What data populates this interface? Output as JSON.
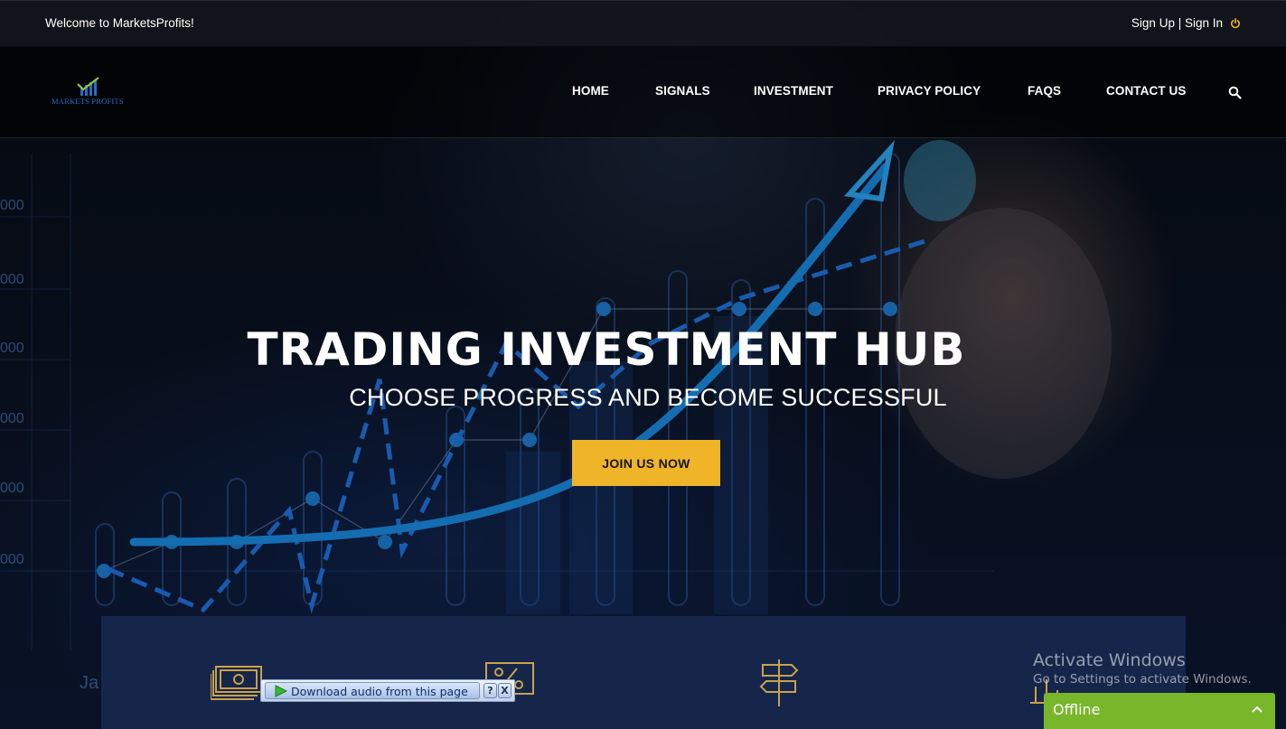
{
  "topbar": {
    "welcome": "Welcome to MarketsProfits!",
    "auth": "Sign Up | Sign In"
  },
  "logo": {
    "text": "MARKETS PROFITS"
  },
  "nav": {
    "items": [
      "HOME",
      "SIGNALS",
      "INVESTMENT",
      "PRIVACY POLICY",
      "FAQS",
      "CONTACT US"
    ]
  },
  "hero": {
    "title": "TRADING INVESTMENT HUB",
    "subtitle": "CHOOSE PROGRESS AND BECOME SUCCESSFUL",
    "cta": "JOIN US NOW"
  },
  "background_chart": {
    "axis_labels": [
      "000",
      "000",
      "000",
      "000",
      "000",
      "000"
    ],
    "month_label": "Ja"
  },
  "watermark": {
    "line1": "Activate Windows",
    "line2": "Go to Settings to activate Windows."
  },
  "chat": {
    "status": "Offline"
  },
  "audio_widget": {
    "label": "Download audio from this page",
    "help": "?",
    "close": "X"
  },
  "colors": {
    "accent": "#f0b428",
    "feature_band": "#16264b",
    "chat_green": "#78b62a",
    "icon_gold": "#c9a14a"
  }
}
